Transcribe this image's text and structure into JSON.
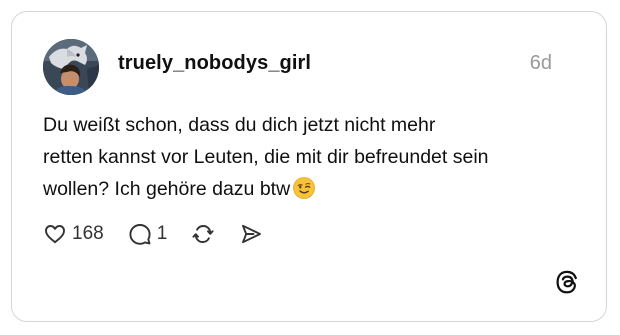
{
  "post": {
    "author": {
      "username": "truely_nobodys_girl",
      "avatar_icon": "profile-photo-avatar"
    },
    "timestamp": "6d",
    "text_lines": [
      "Du weißt schon, dass du dich jetzt nicht mehr",
      "retten kannst vor Leuten, die mit dir befreundet sein",
      "wollen? Ich gehöre dazu btw"
    ],
    "emoji": "winking-face-emoji",
    "actions": {
      "like": {
        "icon": "heart-icon",
        "count": "168"
      },
      "reply": {
        "icon": "comment-bubble-icon",
        "count": "1"
      },
      "repost": {
        "icon": "repost-icon"
      },
      "share": {
        "icon": "send-icon"
      }
    }
  },
  "branding": {
    "logo_icon": "threads-logo-icon"
  },
  "colors": {
    "text": "#101010",
    "muted": "#999999",
    "border": "#d6d6d6",
    "emoji": "#f7c33a"
  }
}
